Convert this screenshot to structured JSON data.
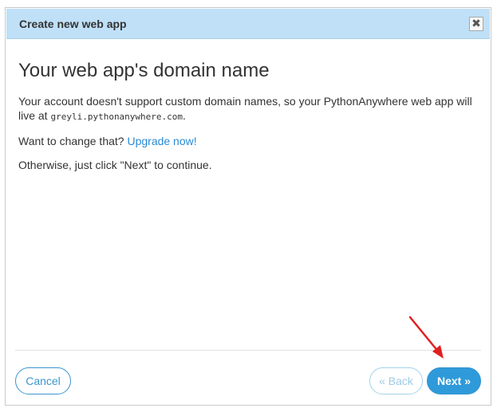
{
  "dialog": {
    "title": "Create new web app",
    "close_icon": "close-icon",
    "close_glyph": "✖"
  },
  "content": {
    "heading": "Your web app's domain name",
    "paragraph1_text": "Your account doesn't support custom domain names, so your PythonAnywhere web app will live at ",
    "domain": "greyli.pythonanywhere.com",
    "paragraph1_end": ".",
    "paragraph2_text": "Want to change that? ",
    "upgrade_link": "Upgrade now!",
    "paragraph3_text": "Otherwise, just click \"Next\" to continue."
  },
  "footer": {
    "cancel_label": "Cancel",
    "back_label": "« Back",
    "next_label": "Next »"
  },
  "colors": {
    "titlebar": "#bfe0f7",
    "link": "#2a8ad4",
    "primary_button": "#2f9ad9",
    "annotation_arrow": "#e02020"
  }
}
